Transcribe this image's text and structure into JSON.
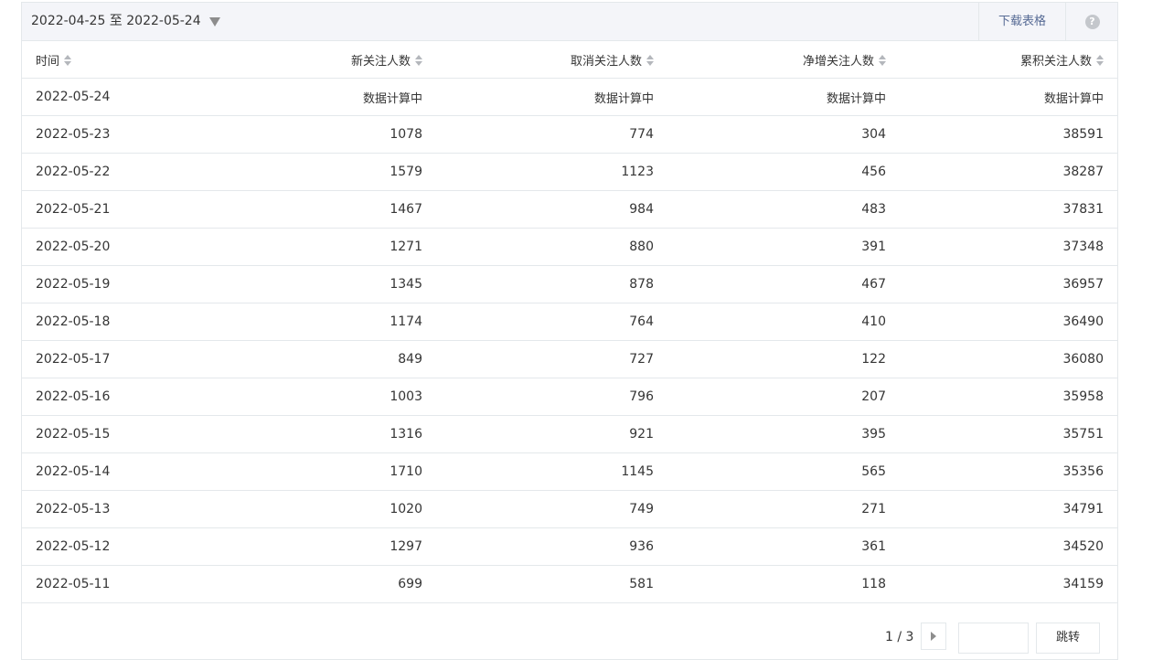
{
  "toolbar": {
    "date_range": "2022-04-25 至 2022-05-24",
    "download_label": "下载表格",
    "help_glyph": "?"
  },
  "table": {
    "columns": [
      "时间",
      "新关注人数",
      "取消关注人数",
      "净增关注人数",
      "累积关注人数"
    ],
    "rows": [
      [
        "2022-05-24",
        "数据计算中",
        "数据计算中",
        "数据计算中",
        "数据计算中"
      ],
      [
        "2022-05-23",
        "1078",
        "774",
        "304",
        "38591"
      ],
      [
        "2022-05-22",
        "1579",
        "1123",
        "456",
        "38287"
      ],
      [
        "2022-05-21",
        "1467",
        "984",
        "483",
        "37831"
      ],
      [
        "2022-05-20",
        "1271",
        "880",
        "391",
        "37348"
      ],
      [
        "2022-05-19",
        "1345",
        "878",
        "467",
        "36957"
      ],
      [
        "2022-05-18",
        "1174",
        "764",
        "410",
        "36490"
      ],
      [
        "2022-05-17",
        "849",
        "727",
        "122",
        "36080"
      ],
      [
        "2022-05-16",
        "1003",
        "796",
        "207",
        "35958"
      ],
      [
        "2022-05-15",
        "1316",
        "921",
        "395",
        "35751"
      ],
      [
        "2022-05-14",
        "1710",
        "1145",
        "565",
        "35356"
      ],
      [
        "2022-05-13",
        "1020",
        "749",
        "271",
        "34791"
      ],
      [
        "2022-05-12",
        "1297",
        "936",
        "361",
        "34520"
      ],
      [
        "2022-05-11",
        "699",
        "581",
        "118",
        "34159"
      ]
    ]
  },
  "pager": {
    "page_info": "1 / 3",
    "input_value": "",
    "jump_label": "跳转"
  },
  "colors": {
    "link": "#576b95",
    "border": "#e4e8eb",
    "toolbar_bg": "#f4f5f9"
  },
  "icons": [
    "caret-down-icon",
    "help-icon",
    "sort-icon",
    "caret-right-icon"
  ]
}
